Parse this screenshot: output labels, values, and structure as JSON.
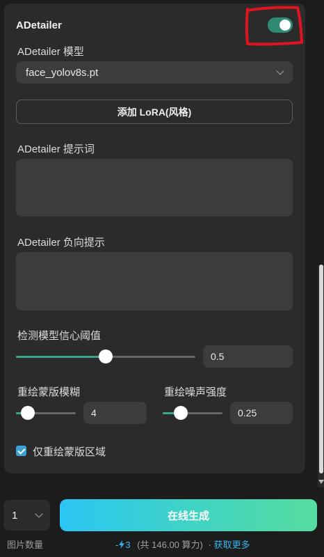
{
  "adetailer": {
    "title": "ADetailer",
    "enabled": true,
    "model_label": "ADetailer 模型",
    "model_value": "face_yolov8s.pt",
    "add_lora_label": "添加 LoRA(风格)",
    "prompt_label": "ADetailer 提示词",
    "prompt_value": "",
    "negative_label": "ADetailer 负向提示",
    "negative_value": "",
    "confidence": {
      "label": "检测模型信心阈值",
      "value": "0.5",
      "level": 0.5
    },
    "mask_blur": {
      "label": "重绘蒙版模糊",
      "value": "4",
      "level": 0.2
    },
    "denoise": {
      "label": "重绘噪声强度",
      "value": "0.25",
      "level": 0.3
    },
    "only_mask_area": {
      "label": "仅重绘蒙版区域",
      "checked": true
    }
  },
  "footer": {
    "count_value": "1",
    "count_label": "图片数量",
    "generate_label": "在线生成",
    "cost_prefix": "-",
    "cost_value": "3",
    "total_text": "(共 146.00 算力)",
    "separator": "·",
    "more_link": "获取更多"
  },
  "colors": {
    "accent": "#3aa58a",
    "link": "#35b6ea",
    "annotation": "#e0141e"
  }
}
